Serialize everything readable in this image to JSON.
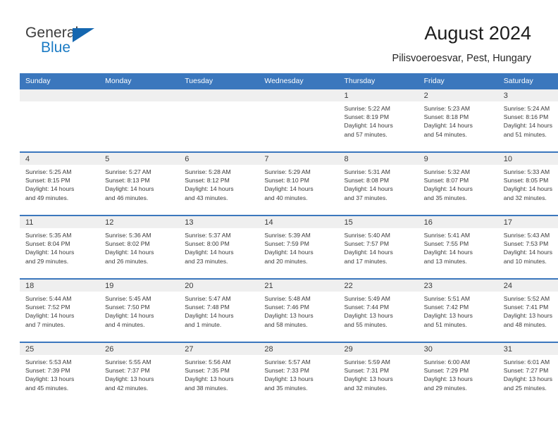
{
  "brand": {
    "name_part1": "General",
    "name_part2": "Blue",
    "flag_icon": "blue-triangle-flag-icon"
  },
  "header": {
    "title": "August 2024",
    "subtitle": "Pilisvoeroesvar, Pest, Hungary"
  },
  "colors": {
    "header_blue": "#3b77bd",
    "brand_blue": "#1b7bc4",
    "daynum_band": "#efefef",
    "text": "#3a3a3a"
  },
  "weekdays": [
    "Sunday",
    "Monday",
    "Tuesday",
    "Wednesday",
    "Thursday",
    "Friday",
    "Saturday"
  ],
  "weeks": [
    [
      {
        "day": "",
        "sunrise": "",
        "sunset": "",
        "daylight1": "",
        "daylight2": "",
        "empty": true
      },
      {
        "day": "",
        "sunrise": "",
        "sunset": "",
        "daylight1": "",
        "daylight2": "",
        "empty": true
      },
      {
        "day": "",
        "sunrise": "",
        "sunset": "",
        "daylight1": "",
        "daylight2": "",
        "empty": true
      },
      {
        "day": "",
        "sunrise": "",
        "sunset": "",
        "daylight1": "",
        "daylight2": "",
        "empty": true
      },
      {
        "day": "1",
        "sunrise": "Sunrise: 5:22 AM",
        "sunset": "Sunset: 8:19 PM",
        "daylight1": "Daylight: 14 hours",
        "daylight2": "and 57 minutes."
      },
      {
        "day": "2",
        "sunrise": "Sunrise: 5:23 AM",
        "sunset": "Sunset: 8:18 PM",
        "daylight1": "Daylight: 14 hours",
        "daylight2": "and 54 minutes."
      },
      {
        "day": "3",
        "sunrise": "Sunrise: 5:24 AM",
        "sunset": "Sunset: 8:16 PM",
        "daylight1": "Daylight: 14 hours",
        "daylight2": "and 51 minutes."
      }
    ],
    [
      {
        "day": "4",
        "sunrise": "Sunrise: 5:25 AM",
        "sunset": "Sunset: 8:15 PM",
        "daylight1": "Daylight: 14 hours",
        "daylight2": "and 49 minutes."
      },
      {
        "day": "5",
        "sunrise": "Sunrise: 5:27 AM",
        "sunset": "Sunset: 8:13 PM",
        "daylight1": "Daylight: 14 hours",
        "daylight2": "and 46 minutes."
      },
      {
        "day": "6",
        "sunrise": "Sunrise: 5:28 AM",
        "sunset": "Sunset: 8:12 PM",
        "daylight1": "Daylight: 14 hours",
        "daylight2": "and 43 minutes."
      },
      {
        "day": "7",
        "sunrise": "Sunrise: 5:29 AM",
        "sunset": "Sunset: 8:10 PM",
        "daylight1": "Daylight: 14 hours",
        "daylight2": "and 40 minutes."
      },
      {
        "day": "8",
        "sunrise": "Sunrise: 5:31 AM",
        "sunset": "Sunset: 8:08 PM",
        "daylight1": "Daylight: 14 hours",
        "daylight2": "and 37 minutes."
      },
      {
        "day": "9",
        "sunrise": "Sunrise: 5:32 AM",
        "sunset": "Sunset: 8:07 PM",
        "daylight1": "Daylight: 14 hours",
        "daylight2": "and 35 minutes."
      },
      {
        "day": "10",
        "sunrise": "Sunrise: 5:33 AM",
        "sunset": "Sunset: 8:05 PM",
        "daylight1": "Daylight: 14 hours",
        "daylight2": "and 32 minutes."
      }
    ],
    [
      {
        "day": "11",
        "sunrise": "Sunrise: 5:35 AM",
        "sunset": "Sunset: 8:04 PM",
        "daylight1": "Daylight: 14 hours",
        "daylight2": "and 29 minutes."
      },
      {
        "day": "12",
        "sunrise": "Sunrise: 5:36 AM",
        "sunset": "Sunset: 8:02 PM",
        "daylight1": "Daylight: 14 hours",
        "daylight2": "and 26 minutes."
      },
      {
        "day": "13",
        "sunrise": "Sunrise: 5:37 AM",
        "sunset": "Sunset: 8:00 PM",
        "daylight1": "Daylight: 14 hours",
        "daylight2": "and 23 minutes."
      },
      {
        "day": "14",
        "sunrise": "Sunrise: 5:39 AM",
        "sunset": "Sunset: 7:59 PM",
        "daylight1": "Daylight: 14 hours",
        "daylight2": "and 20 minutes."
      },
      {
        "day": "15",
        "sunrise": "Sunrise: 5:40 AM",
        "sunset": "Sunset: 7:57 PM",
        "daylight1": "Daylight: 14 hours",
        "daylight2": "and 17 minutes."
      },
      {
        "day": "16",
        "sunrise": "Sunrise: 5:41 AM",
        "sunset": "Sunset: 7:55 PM",
        "daylight1": "Daylight: 14 hours",
        "daylight2": "and 13 minutes."
      },
      {
        "day": "17",
        "sunrise": "Sunrise: 5:43 AM",
        "sunset": "Sunset: 7:53 PM",
        "daylight1": "Daylight: 14 hours",
        "daylight2": "and 10 minutes."
      }
    ],
    [
      {
        "day": "18",
        "sunrise": "Sunrise: 5:44 AM",
        "sunset": "Sunset: 7:52 PM",
        "daylight1": "Daylight: 14 hours",
        "daylight2": "and 7 minutes."
      },
      {
        "day": "19",
        "sunrise": "Sunrise: 5:45 AM",
        "sunset": "Sunset: 7:50 PM",
        "daylight1": "Daylight: 14 hours",
        "daylight2": "and 4 minutes."
      },
      {
        "day": "20",
        "sunrise": "Sunrise: 5:47 AM",
        "sunset": "Sunset: 7:48 PM",
        "daylight1": "Daylight: 14 hours",
        "daylight2": "and 1 minute."
      },
      {
        "day": "21",
        "sunrise": "Sunrise: 5:48 AM",
        "sunset": "Sunset: 7:46 PM",
        "daylight1": "Daylight: 13 hours",
        "daylight2": "and 58 minutes."
      },
      {
        "day": "22",
        "sunrise": "Sunrise: 5:49 AM",
        "sunset": "Sunset: 7:44 PM",
        "daylight1": "Daylight: 13 hours",
        "daylight2": "and 55 minutes."
      },
      {
        "day": "23",
        "sunrise": "Sunrise: 5:51 AM",
        "sunset": "Sunset: 7:42 PM",
        "daylight1": "Daylight: 13 hours",
        "daylight2": "and 51 minutes."
      },
      {
        "day": "24",
        "sunrise": "Sunrise: 5:52 AM",
        "sunset": "Sunset: 7:41 PM",
        "daylight1": "Daylight: 13 hours",
        "daylight2": "and 48 minutes."
      }
    ],
    [
      {
        "day": "25",
        "sunrise": "Sunrise: 5:53 AM",
        "sunset": "Sunset: 7:39 PM",
        "daylight1": "Daylight: 13 hours",
        "daylight2": "and 45 minutes."
      },
      {
        "day": "26",
        "sunrise": "Sunrise: 5:55 AM",
        "sunset": "Sunset: 7:37 PM",
        "daylight1": "Daylight: 13 hours",
        "daylight2": "and 42 minutes."
      },
      {
        "day": "27",
        "sunrise": "Sunrise: 5:56 AM",
        "sunset": "Sunset: 7:35 PM",
        "daylight1": "Daylight: 13 hours",
        "daylight2": "and 38 minutes."
      },
      {
        "day": "28",
        "sunrise": "Sunrise: 5:57 AM",
        "sunset": "Sunset: 7:33 PM",
        "daylight1": "Daylight: 13 hours",
        "daylight2": "and 35 minutes."
      },
      {
        "day": "29",
        "sunrise": "Sunrise: 5:59 AM",
        "sunset": "Sunset: 7:31 PM",
        "daylight1": "Daylight: 13 hours",
        "daylight2": "and 32 minutes."
      },
      {
        "day": "30",
        "sunrise": "Sunrise: 6:00 AM",
        "sunset": "Sunset: 7:29 PM",
        "daylight1": "Daylight: 13 hours",
        "daylight2": "and 29 minutes."
      },
      {
        "day": "31",
        "sunrise": "Sunrise: 6:01 AM",
        "sunset": "Sunset: 7:27 PM",
        "daylight1": "Daylight: 13 hours",
        "daylight2": "and 25 minutes."
      }
    ]
  ]
}
